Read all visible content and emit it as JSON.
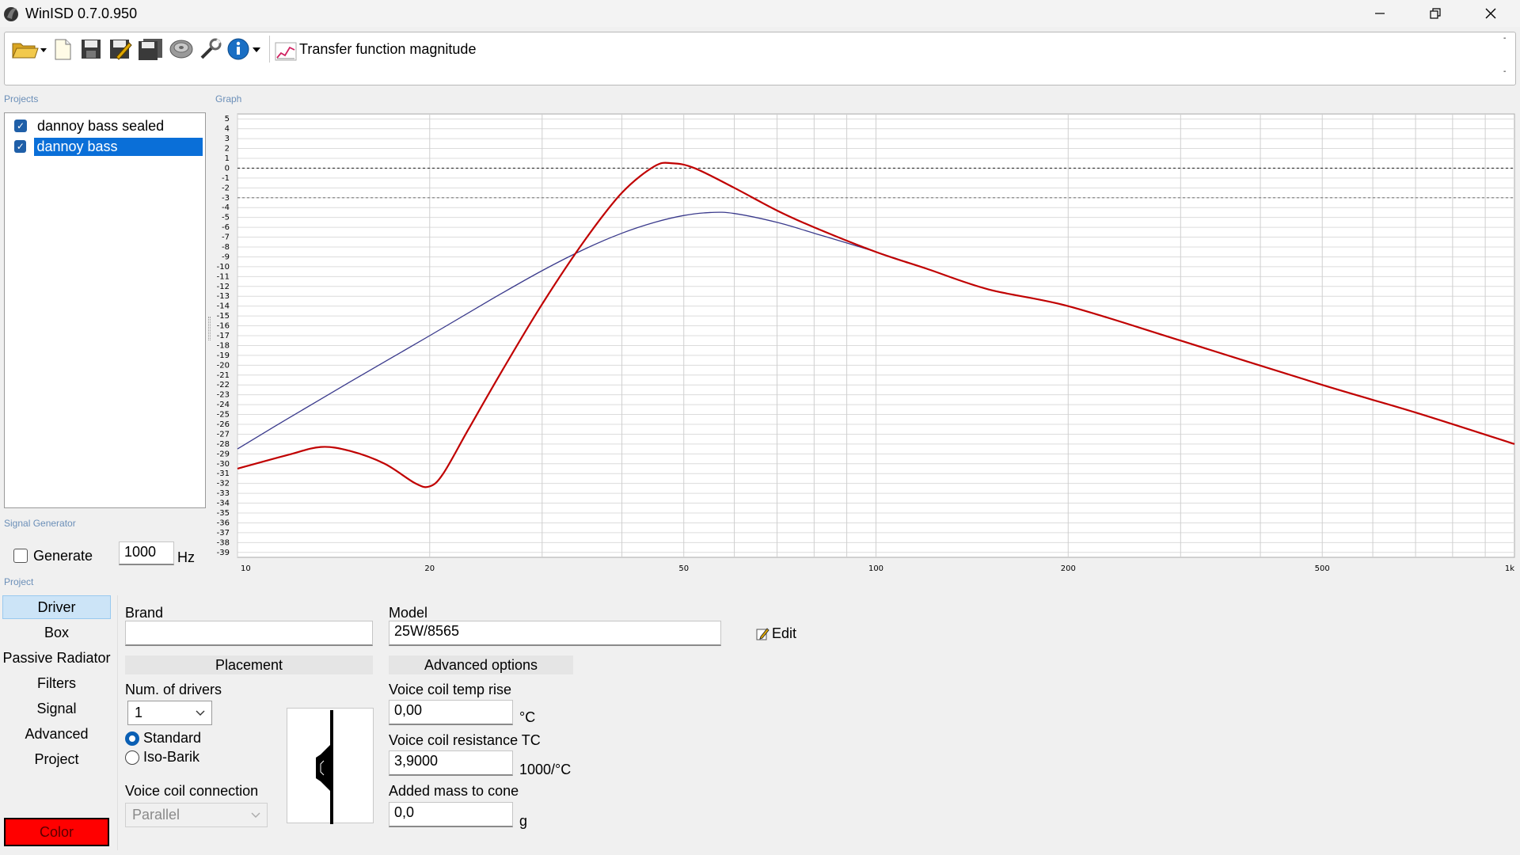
{
  "window": {
    "title": "WinISD 0.7.0.950",
    "minimize_glyph": "—",
    "restore_glyph": "❐",
    "close_glyph": "✕"
  },
  "toolbar": {
    "icons": [
      "open-folder-icon",
      "new-document-icon",
      "save-icon",
      "save-as-icon",
      "save-all-icon",
      "driver-database-icon",
      "tools-icon",
      "info-icon"
    ],
    "graph_type_label": "Transfer function magnitude"
  },
  "projects": {
    "section_label": "Projects",
    "items": [
      {
        "label": "dannoy bass sealed",
        "checked": true,
        "selected": false
      },
      {
        "label": "dannoy bass",
        "checked": true,
        "selected": true
      }
    ]
  },
  "signal_generator": {
    "section_label": "Signal Generator",
    "generate_label": "Generate",
    "frequency_value": "1000",
    "unit": "Hz"
  },
  "graph": {
    "section_label": "Graph"
  },
  "chart_data": {
    "type": "line",
    "title": "",
    "xlabel": "",
    "ylabel": "",
    "x_scale": "log",
    "xlim": [
      10,
      1000
    ],
    "ylim": [
      -39,
      5
    ],
    "y_ticks": [
      5,
      4,
      3,
      2,
      1,
      0,
      -1,
      -2,
      -3,
      -4,
      -5,
      -6,
      -7,
      -8,
      -9,
      -10,
      -11,
      -12,
      -13,
      -14,
      -15,
      -16,
      -17,
      -18,
      -19,
      -20,
      -21,
      -22,
      -23,
      -24,
      -25,
      -26,
      -27,
      -28,
      -29,
      -30,
      -31,
      -32,
      -33,
      -34,
      -35,
      -36,
      -37,
      -38,
      -39
    ],
    "x_tick_labels": [
      {
        "value": 10,
        "label": "10"
      },
      {
        "value": 20,
        "label": "20"
      },
      {
        "value": 50,
        "label": "50"
      },
      {
        "value": 100,
        "label": "100"
      },
      {
        "value": 200,
        "label": "200"
      },
      {
        "value": 500,
        "label": "500"
      },
      {
        "value": 1000,
        "label": "1k"
      }
    ],
    "reference_lines": [
      0,
      -3
    ],
    "grid": true,
    "series": [
      {
        "color": "#3a3a8c",
        "x": [
          10,
          12,
          15,
          20,
          25,
          30,
          35,
          40,
          45,
          50,
          55,
          60,
          70,
          80,
          100,
          120,
          150,
          200,
          300,
          500,
          700,
          1000
        ],
        "y": [
          -28.5,
          -25.4,
          -21.7,
          -17.0,
          -13.3,
          -10.4,
          -8.2,
          -6.6,
          -5.5,
          -4.8,
          -4.5,
          -4.6,
          -5.5,
          -6.6,
          -8.5,
          -10.2,
          -12.3,
          -14.0,
          -17.5,
          -22.0,
          -24.8,
          -28.0
        ]
      },
      {
        "color": "#c00000",
        "x": [
          10,
          12,
          13.5,
          15,
          17,
          19,
          20,
          21,
          23,
          26,
          30,
          35,
          40,
          45,
          48,
          52,
          60,
          70,
          80,
          100,
          120,
          150,
          200,
          300,
          500,
          700,
          1000
        ],
        "y": [
          -30.5,
          -29.1,
          -28.3,
          -28.7,
          -30.0,
          -32.0,
          -32.3,
          -31.0,
          -26.5,
          -20.5,
          -13.8,
          -7.3,
          -2.5,
          0.2,
          0.5,
          0.0,
          -2.0,
          -4.3,
          -6.0,
          -8.5,
          -10.2,
          -12.3,
          -14.0,
          -17.5,
          -22.0,
          -24.8,
          -28.0
        ]
      }
    ]
  },
  "project": {
    "section_label": "Project",
    "tabs": [
      "Driver",
      "Box",
      "Passive Radiator",
      "Filters",
      "Signal",
      "Advanced",
      "Project"
    ],
    "active_tab": "Driver",
    "color_button": "Color",
    "color_swatch": "#ff0000"
  },
  "driver": {
    "brand_label": "Brand",
    "brand_value": "",
    "model_label": "Model",
    "model_value": "25W/8565",
    "edit_label": "Edit",
    "placement_header": "Placement",
    "num_drivers_label": "Num. of drivers",
    "num_drivers_value": "1",
    "radio_standard": "Standard",
    "radio_isobarik": "Iso-Barik",
    "selected_placement": "Standard",
    "vc_connection_label": "Voice coil connection",
    "vc_connection_value": "Parallel",
    "advanced_header": "Advanced options",
    "vc_temp_rise_label": "Voice coil temp rise",
    "vc_temp_rise_value": "0,00",
    "vc_temp_rise_unit": "°C",
    "vc_resistance_tc_label": "Voice coil resistance TC",
    "vc_resistance_tc_value": "3,9000",
    "vc_resistance_tc_unit": "1000/°C",
    "added_mass_label": "Added mass to cone",
    "added_mass_value": "0,0",
    "added_mass_unit": "g"
  }
}
